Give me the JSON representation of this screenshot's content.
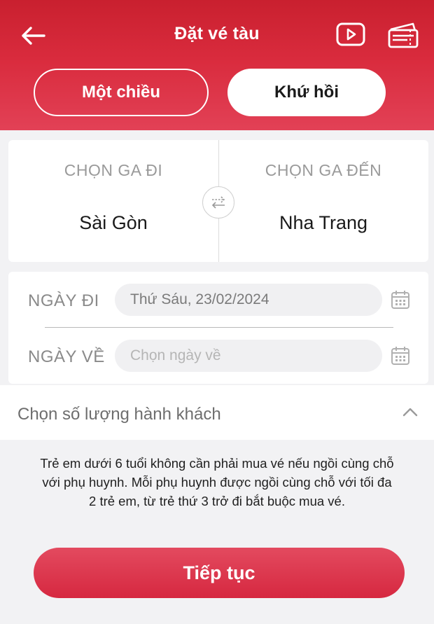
{
  "header": {
    "title": "Đặt vé tàu",
    "back_icon": "arrow-left-icon",
    "video_icon": "video-play-icon",
    "ticket_icon": "ticket-icon"
  },
  "trip_type": {
    "one_way_label": "Một chiều",
    "round_trip_label": "Khứ hồi",
    "selected": "Khứ hồi"
  },
  "stations": {
    "from_label": "CHỌN GA ĐI",
    "from_value": "Sài Gòn",
    "to_label": "CHỌN GA ĐẾN",
    "to_value": "Nha Trang",
    "swap_icon": "swap-arrows-icon"
  },
  "dates": {
    "depart_label": "NGÀY ĐI",
    "depart_value": "Thứ Sáu, 23/02/2024",
    "return_label": "NGÀY VỀ",
    "return_placeholder": "Chọn ngày về",
    "calendar_icon": "calendar-icon"
  },
  "passengers": {
    "label": "Chọn số lượng hành khách",
    "chevron_icon": "chevron-up-icon"
  },
  "note": {
    "line1": "Trẻ em dưới 6 tuổi không cần phải mua vé nếu ngồi cùng chỗ",
    "line2": "với phụ huynh. Mỗi phụ huynh được ngồi cùng chỗ với tối đa",
    "line3": "2 trẻ em, từ trẻ thứ 3 trở đi bắt buộc mua vé."
  },
  "actions": {
    "continue_label": "Tiếp tục"
  },
  "colors": {
    "brand_red": "#d92b3d",
    "button_red": "#dc3a50"
  }
}
